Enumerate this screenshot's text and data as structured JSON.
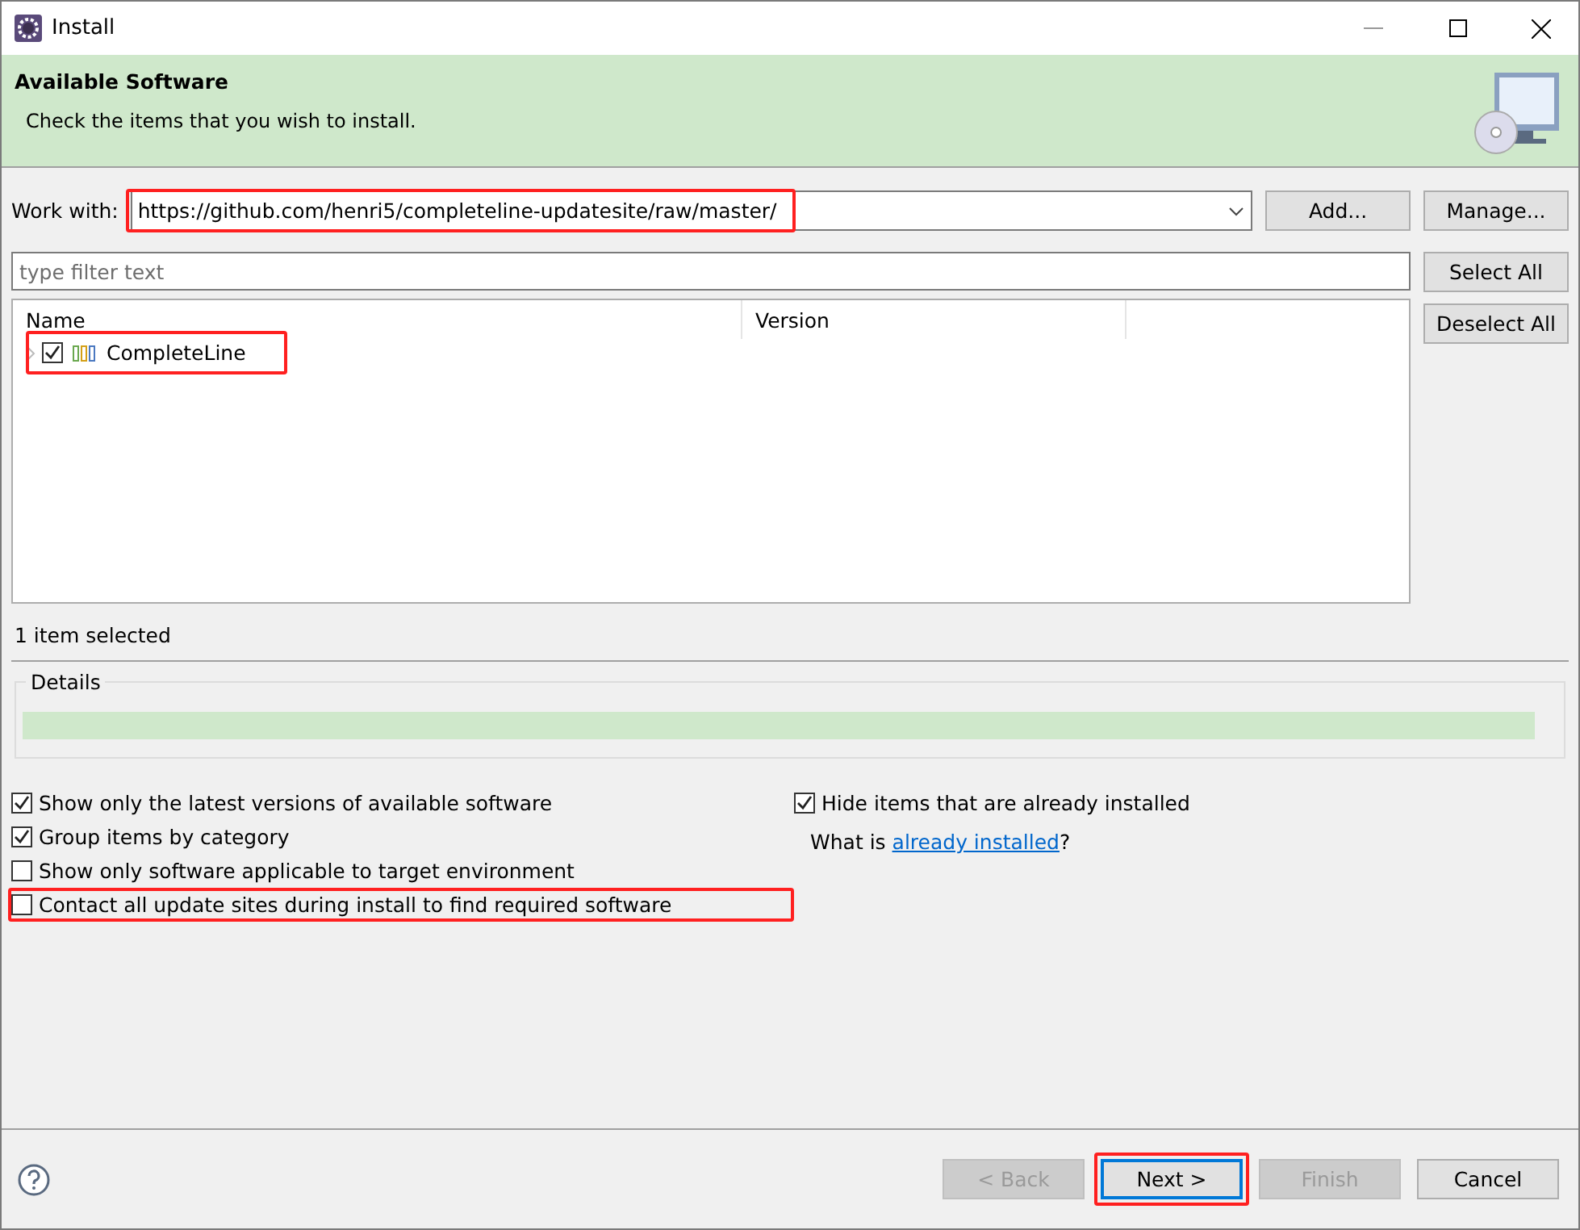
{
  "window": {
    "title": "Install"
  },
  "banner": {
    "title": "Available Software",
    "subtitle": "Check the items that you wish to install."
  },
  "work_with": {
    "label": "Work with:",
    "value": "https://github.com/henri5/completeline-updatesite/raw/master/",
    "highlighted": true
  },
  "add_button": "Add...",
  "manage_button": "Manage...",
  "filter": {
    "placeholder": "type filter text"
  },
  "tree": {
    "columns": [
      "Name",
      "Version"
    ],
    "items": [
      {
        "name": "CompleteLine",
        "checked": true,
        "expanded": false,
        "highlighted": true
      }
    ]
  },
  "side_buttons": [
    "Select All",
    "Deselect All"
  ],
  "selection_status": "1 item selected",
  "details": {
    "title": "Details"
  },
  "options_left": [
    {
      "label": "Show only the latest versions of available software",
      "checked": true,
      "highlighted": false
    },
    {
      "label": "Group items by category",
      "checked": true,
      "highlighted": false
    },
    {
      "label": "Show only software applicable to target environment",
      "checked": false,
      "highlighted": false
    },
    {
      "label": "Contact all update sites during install to find required software",
      "checked": false,
      "highlighted": true
    }
  ],
  "options_right": [
    {
      "label": "Hide items that are already installed",
      "checked": true
    }
  ],
  "installed_note": {
    "prefix": "What is ",
    "link": "already installed",
    "suffix": "?"
  },
  "footer_buttons": [
    {
      "label": "< Back",
      "disabled": true,
      "default": false,
      "highlighted": false
    },
    {
      "label": "Next >",
      "disabled": false,
      "default": true,
      "highlighted": true
    },
    {
      "label": "Finish",
      "disabled": true,
      "default": false,
      "highlighted": false
    },
    {
      "label": "Cancel",
      "disabled": false,
      "default": false,
      "highlighted": false
    }
  ]
}
